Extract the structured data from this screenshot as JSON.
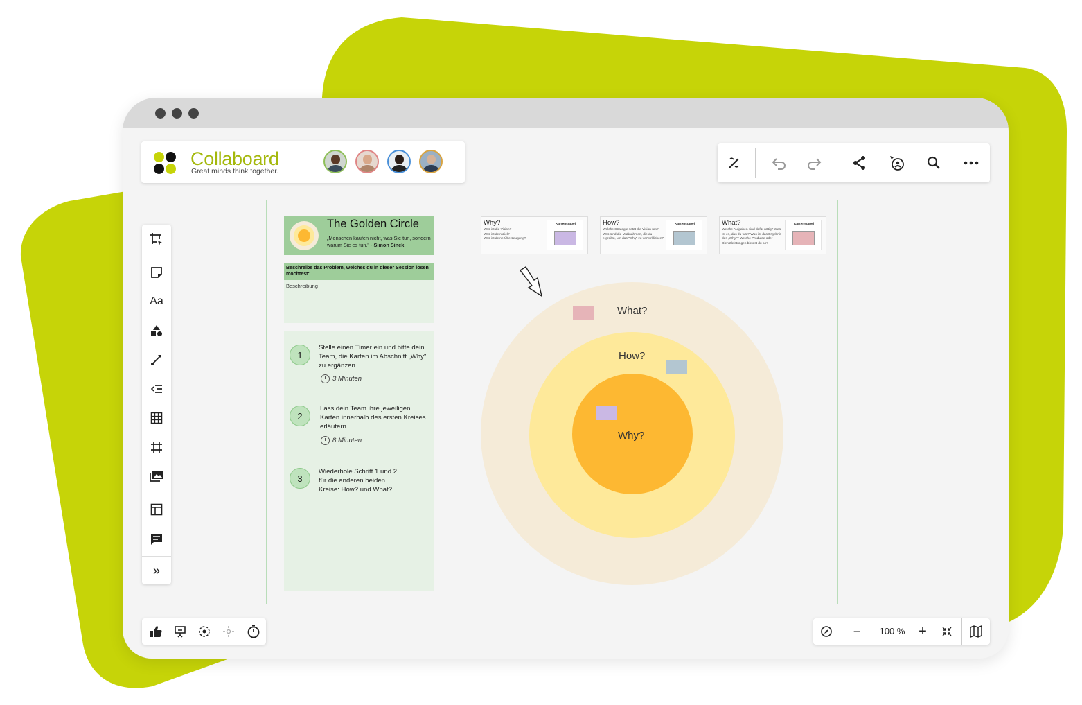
{
  "colors": {
    "brand_green": "#c6d408",
    "circle_outer": "#f5ebd8",
    "circle_middle": "#fee99a",
    "circle_inner": "#fdb832",
    "panel_green": "#9ecd9a",
    "panel_light": "#e6f1e5",
    "sticky_pink": "#e6b4b8",
    "sticky_blue": "#b3c6d1",
    "sticky_purple": "#cab8e4"
  },
  "header": {
    "brand": "Collaboard",
    "tagline": "Great minds think together.",
    "avatars": [
      "user-avatar-1",
      "user-avatar-2",
      "user-avatar-3",
      "user-avatar-4"
    ]
  },
  "top_tools": [
    "magic-pen-icon",
    "undo-icon",
    "redo-icon",
    "share-icon",
    "follow-presenter-icon",
    "search-icon",
    "more-icon"
  ],
  "left_tools": {
    "items": [
      "select-frame-icon",
      "sticky-note-icon",
      "text-tool",
      "shapes-icon",
      "connector-icon",
      "list-icon",
      "table-icon",
      "frame-icon",
      "image-icon",
      "template-icon",
      "comment-icon",
      "expand-icon"
    ],
    "text_tool_label": "Aa",
    "expand_label": "»"
  },
  "bottom_left": [
    "like-icon",
    "presentation-icon",
    "focus-icon",
    "attention-icon",
    "timer-icon"
  ],
  "bottom_right": {
    "zoom": "100 %",
    "minus": "−",
    "plus": "+"
  },
  "board": {
    "golden_circle": {
      "title": "The Golden Circle",
      "quote": "„Menschen kaufen nicht, was Sie tun, sondern warum Sie es tun.\" - ",
      "author": "Simon Sinek"
    },
    "problem": {
      "heading": "Beschreibe das Problem, welches du in dieser Session lösen möchtest:",
      "placeholder": "Beschreibung"
    },
    "steps": [
      {
        "number": "1",
        "text": "Stelle einen Timer ein und bitte dein Team, die Karten im Abschnitt „Why\" zu ergänzen.",
        "time": "3 Minuten"
      },
      {
        "number": "2",
        "text": "Lass dein Team ihre jeweiligen Karten innerhalb des ersten Kreises erläutern.",
        "time": "8 Minuten"
      },
      {
        "number": "3",
        "text": "Wiederhole Schritt 1 und 2 für die anderen beiden Kreise: How? und What?",
        "time": ""
      }
    ],
    "cards": [
      {
        "title": "Why?",
        "desc": "Was ist die Vision?\nWas ist dein Ziel?\nWas ist deine Überzeugung?",
        "stack_label": "Kartenstapel",
        "color": "#cab8e4"
      },
      {
        "title": "How?",
        "desc": "Welche Strategie setzt die Vision um? Was sind die Maßnahmen, die du ergreifst, um das \"Why\" zu verwirklichen?",
        "stack_label": "Kartenstapel",
        "color": "#b3c6d1"
      },
      {
        "title": "What?",
        "desc": "Welche Aufgaben sind dafür nötig? Was ist es, das du tust? Was ist das Ergebnis des „Why\"? Welche Produkte oder Dienstleistungen bietest du an?",
        "stack_label": "Kartenstapel",
        "color": "#e6b4b8"
      }
    ],
    "circles": {
      "outer": "What?",
      "middle": "How?",
      "inner": "Why?"
    }
  }
}
